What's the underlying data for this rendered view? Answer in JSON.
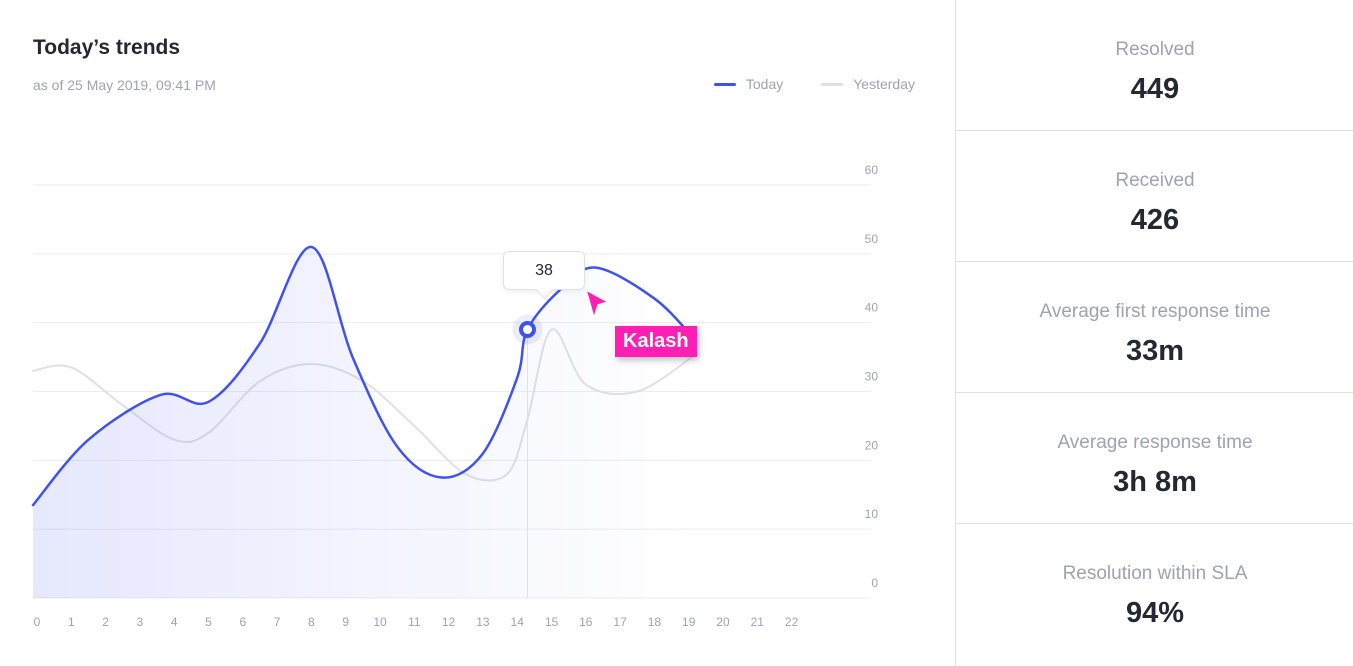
{
  "chart_panel": {
    "title": "Today’s trends",
    "subtitle": "as of 25 May 2019, 09:41 PM",
    "legend": [
      {
        "label": "Today",
        "color": "#3f51f0"
      },
      {
        "label": "Yesterday",
        "color": "#dfe0eb"
      }
    ],
    "tooltip_value": "38",
    "cursor_label": "Kalash",
    "cursor_color": "#ff1fb4"
  },
  "chart_data": {
    "type": "area",
    "x_ticks": [
      "0",
      "1",
      "2",
      "3",
      "4",
      "5",
      "6",
      "7",
      "8",
      "9",
      "10",
      "11",
      "12",
      "13",
      "14",
      "15",
      "16",
      "17",
      "18",
      "19",
      "20",
      "21",
      "22"
    ],
    "y_ticks": [
      "0",
      "10",
      "20",
      "30",
      "40",
      "50",
      "60"
    ],
    "xlim": [
      0,
      22
    ],
    "ylim": [
      0,
      60
    ],
    "grid": true,
    "legend_position": "top-right",
    "series": [
      {
        "name": "Today",
        "color": "#3f51f0",
        "filled": true,
        "points": [
          [
            0,
            13.5
          ],
          [
            1.5,
            23
          ],
          [
            3.6,
            29.5
          ],
          [
            5,
            28.5
          ],
          [
            6.5,
            37
          ],
          [
            8,
            51
          ],
          [
            9.2,
            35
          ],
          [
            10.5,
            22
          ],
          [
            11.8,
            17.5
          ],
          [
            13,
            21
          ],
          [
            14,
            32
          ],
          [
            14.3,
            39
          ],
          [
            15.3,
            45
          ],
          [
            16.3,
            48
          ],
          [
            18,
            43.5
          ],
          [
            19.1,
            38
          ]
        ]
      },
      {
        "name": "Yesterday",
        "color": "#dfe0eb",
        "filled": false,
        "points": [
          [
            0,
            33
          ],
          [
            1,
            33.5
          ],
          [
            2.5,
            28
          ],
          [
            4,
            23
          ],
          [
            5,
            24
          ],
          [
            6.5,
            31.5
          ],
          [
            8,
            34
          ],
          [
            9.5,
            31.5
          ],
          [
            11,
            25
          ],
          [
            12.5,
            18
          ],
          [
            13.7,
            18
          ],
          [
            14.3,
            26
          ],
          [
            15,
            39
          ],
          [
            16,
            31
          ],
          [
            17.5,
            30
          ],
          [
            19.1,
            35
          ]
        ]
      }
    ],
    "highlight": {
      "series": "Today",
      "x": 14.3,
      "y": 39,
      "label": "38"
    }
  },
  "stats": [
    {
      "label": "Resolved",
      "value": "449"
    },
    {
      "label": "Received",
      "value": "426"
    },
    {
      "label": "Average first response time",
      "value": "33m"
    },
    {
      "label": "Average response time",
      "value": "3h 8m"
    },
    {
      "label": "Resolution within SLA",
      "value": "94%"
    }
  ]
}
